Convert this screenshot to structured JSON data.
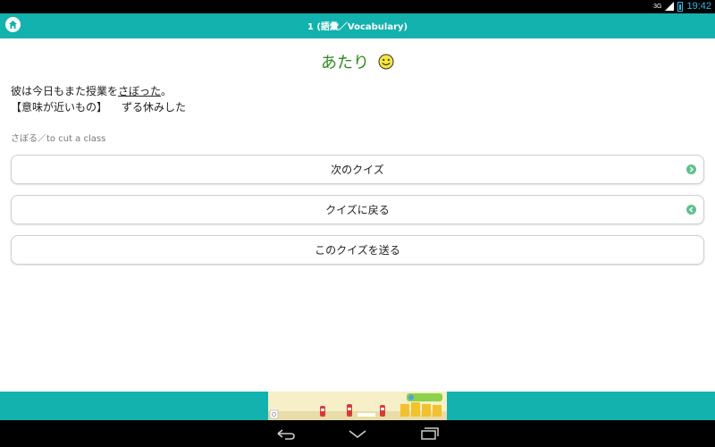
{
  "status_bar": {
    "network": "3G",
    "clock": "19:42"
  },
  "app_bar": {
    "title": "1 (語彙／Vocabulary)",
    "home_icon": "home-icon"
  },
  "result": {
    "label": "あたり",
    "icon": "smiley-icon"
  },
  "question": {
    "sentence_before": "彼は今日もまた授業を",
    "sentence_target": "さぼった",
    "sentence_after": "。",
    "meaning_label": "【意味が近いもの】",
    "meaning_answer": "ずる休みした"
  },
  "hint": "さぼる／to cut a class",
  "buttons": [
    {
      "label": "次のクイズ",
      "icon": "chevron-right-icon"
    },
    {
      "label": "クイズに戻る",
      "icon": "chevron-left-icon"
    },
    {
      "label": "このクイズを送る"
    }
  ],
  "colors": {
    "teal": "#13b2ae",
    "correct_green": "#2e8b1e",
    "arrow_green": "#5fc08f"
  },
  "nav_bar": {
    "icons": [
      "back-icon",
      "home-nav-icon",
      "recent-apps-icon"
    ]
  }
}
